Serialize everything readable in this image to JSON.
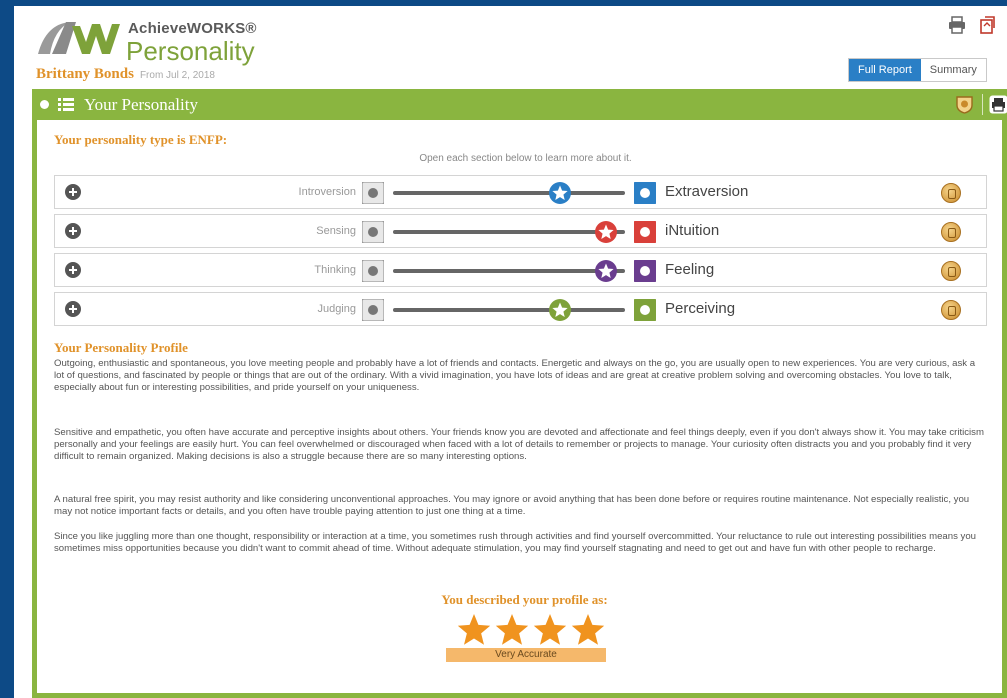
{
  "header": {
    "brand_top": "AchieveWORKS®",
    "brand_bottom": "Personality",
    "student_name": "Brittany Bonds",
    "student_date": "From Jul 2, 2018"
  },
  "tabs": [
    {
      "label": "Full Report",
      "active": true
    },
    {
      "label": "Summary",
      "active": false
    }
  ],
  "panel": {
    "title": "Your Personality",
    "type_heading": "Your personality type is ENFP:",
    "instruction": "Open each section below to learn more about it."
  },
  "dimensions": [
    {
      "left": "Introversion",
      "right": "Extraversion",
      "value": 0.72,
      "star_color": "#2a7fc6",
      "left_icon": "people-group-icon",
      "right_icon": "people-puzzle-icon"
    },
    {
      "left": "Sensing",
      "right": "iNtuition",
      "value": 0.92,
      "star_color": "#d9403a",
      "left_icon": "eye-icon",
      "right_icon": "lightbulb-icon"
    },
    {
      "left": "Thinking",
      "right": "Feeling",
      "value": 0.92,
      "star_color": "#6a3d8f",
      "left_icon": "brain-icon",
      "right_icon": "heart-icon"
    },
    {
      "left": "Judging",
      "right": "Perceiving",
      "value": 0.72,
      "star_color": "#7ea23a",
      "left_icon": "checklist-icon",
      "right_icon": "puzzle-icon"
    }
  ],
  "profile": {
    "heading": "Your Personality Profile",
    "paragraphs": [
      "Outgoing, enthusiastic and spontaneous, you love meeting people and probably have a lot of friends and contacts. Energetic and always on the go, you are usually open to new experiences. You are very curious, ask a lot of questions, and fascinated by people or things that are out of the ordinary. With a vivid imagination, you have lots of ideas and are great at creative problem solving and overcoming obstacles. You love to talk, especially about fun or interesting possibilities, and pride yourself on your uniqueness.",
      "Sensitive and empathetic, you often have accurate and perceptive insights about others. Your friends know you are devoted and affectionate and feel things deeply, even if you don't always show it. You may take criticism personally and your feelings are easily hurt. You can feel overwhelmed or discouraged when faced with a lot of details to remember or projects to manage. Your curiosity often distracts you and you probably find it very difficult to remain organized. Making decisions is also a struggle because there are so many interesting options.",
      "A natural free spirit, you may resist authority and like considering unconventional approaches. You may ignore or avoid anything that has been done before or requires routine maintenance. Not especially realistic, you may not notice important facts or details, and you often have trouble paying attention to just one thing at a time.",
      "Since you like juggling more than one thought, responsibility or interaction at a time, you sometimes rush through activities and find yourself overcommitted. Your reluctance to rule out interesting possibilities means you sometimes miss opportunities because you didn't want to commit ahead of time. Without adequate stimulation, you may find yourself stagnating and need to get out and have fun with other people to recharge."
    ]
  },
  "rating": {
    "heading": "You described your profile as:",
    "stars": 4,
    "label": "Very Accurate",
    "star_color": "#f0931e"
  },
  "colors": {
    "accent_green": "#8ab540",
    "accent_orange": "#e0922a",
    "tab_blue": "#2a7fc6",
    "background_blue": "#0d4a86"
  }
}
